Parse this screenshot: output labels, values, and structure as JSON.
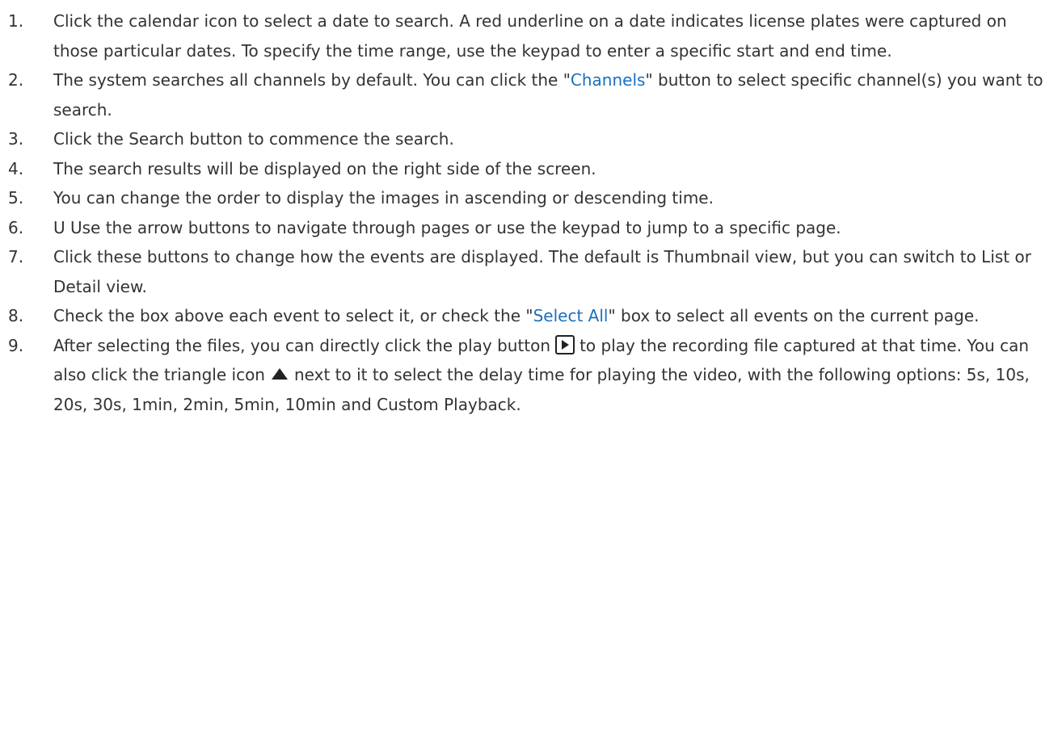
{
  "steps": [
    {
      "num": "1.",
      "text": "Click the calendar icon to select a date to search. A red underline on a date indicates license plates were captured on those particular dates. To specify the time range, use the keypad to enter a specific start and end time."
    },
    {
      "num": "2.",
      "before": "The system searches all channels by default. You can click the \"",
      "link": "Channels",
      "after": "\" button to select specific channel(s) you want to search."
    },
    {
      "num": "3.",
      "text": "Click the Search button to commence the search."
    },
    {
      "num": "4.",
      "text": "The search results will be displayed on the right side of the screen."
    },
    {
      "num": "5.",
      "text": "You can change the order to display the images in ascending or descending time."
    },
    {
      "num": "6.",
      "text": "U Use the arrow buttons to navigate through pages or use the keypad to jump to a specific page."
    },
    {
      "num": "7.",
      "text": "Click these buttons to change how the events are displayed. The default is Thumbnail view, but you can switch to List or Detail view."
    },
    {
      "num": "8.",
      "before": "Check the box above each event to select it, or check the \"",
      "link": "Select All",
      "after": "\" box to select all events on the current page."
    },
    {
      "num": "9.",
      "part1": "After selecting the files, you can directly click the play button",
      "part2": "to play the recording file captured at that time. You can also click the triangle icon",
      "part3": "next to it to select the delay time for playing the video, with the following options: 5s, 10s, 20s, 30s, 1min, 2min, 5min, 10min and Custom Playback.",
      "icons": [
        "play-button-icon",
        "triangle-up-icon"
      ]
    }
  ]
}
